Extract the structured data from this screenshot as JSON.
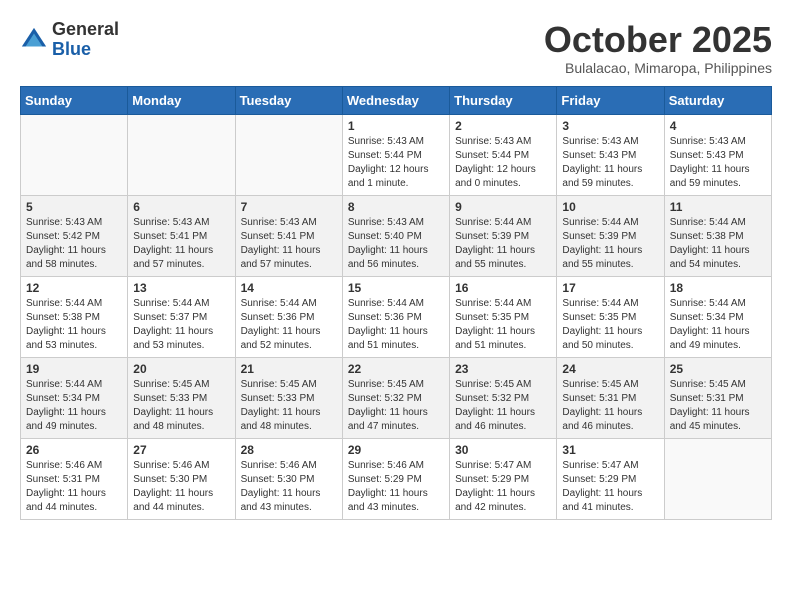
{
  "header": {
    "logo_general": "General",
    "logo_blue": "Blue",
    "month": "October 2025",
    "location": "Bulalacao, Mimaropa, Philippines"
  },
  "calendar": {
    "days_of_week": [
      "Sunday",
      "Monday",
      "Tuesday",
      "Wednesday",
      "Thursday",
      "Friday",
      "Saturday"
    ],
    "weeks": [
      [
        {
          "day": "",
          "info": ""
        },
        {
          "day": "",
          "info": ""
        },
        {
          "day": "",
          "info": ""
        },
        {
          "day": "1",
          "info": "Sunrise: 5:43 AM\nSunset: 5:44 PM\nDaylight: 12 hours\nand 1 minute."
        },
        {
          "day": "2",
          "info": "Sunrise: 5:43 AM\nSunset: 5:44 PM\nDaylight: 12 hours\nand 0 minutes."
        },
        {
          "day": "3",
          "info": "Sunrise: 5:43 AM\nSunset: 5:43 PM\nDaylight: 11 hours\nand 59 minutes."
        },
        {
          "day": "4",
          "info": "Sunrise: 5:43 AM\nSunset: 5:43 PM\nDaylight: 11 hours\nand 59 minutes."
        }
      ],
      [
        {
          "day": "5",
          "info": "Sunrise: 5:43 AM\nSunset: 5:42 PM\nDaylight: 11 hours\nand 58 minutes."
        },
        {
          "day": "6",
          "info": "Sunrise: 5:43 AM\nSunset: 5:41 PM\nDaylight: 11 hours\nand 57 minutes."
        },
        {
          "day": "7",
          "info": "Sunrise: 5:43 AM\nSunset: 5:41 PM\nDaylight: 11 hours\nand 57 minutes."
        },
        {
          "day": "8",
          "info": "Sunrise: 5:43 AM\nSunset: 5:40 PM\nDaylight: 11 hours\nand 56 minutes."
        },
        {
          "day": "9",
          "info": "Sunrise: 5:44 AM\nSunset: 5:39 PM\nDaylight: 11 hours\nand 55 minutes."
        },
        {
          "day": "10",
          "info": "Sunrise: 5:44 AM\nSunset: 5:39 PM\nDaylight: 11 hours\nand 55 minutes."
        },
        {
          "day": "11",
          "info": "Sunrise: 5:44 AM\nSunset: 5:38 PM\nDaylight: 11 hours\nand 54 minutes."
        }
      ],
      [
        {
          "day": "12",
          "info": "Sunrise: 5:44 AM\nSunset: 5:38 PM\nDaylight: 11 hours\nand 53 minutes."
        },
        {
          "day": "13",
          "info": "Sunrise: 5:44 AM\nSunset: 5:37 PM\nDaylight: 11 hours\nand 53 minutes."
        },
        {
          "day": "14",
          "info": "Sunrise: 5:44 AM\nSunset: 5:36 PM\nDaylight: 11 hours\nand 52 minutes."
        },
        {
          "day": "15",
          "info": "Sunrise: 5:44 AM\nSunset: 5:36 PM\nDaylight: 11 hours\nand 51 minutes."
        },
        {
          "day": "16",
          "info": "Sunrise: 5:44 AM\nSunset: 5:35 PM\nDaylight: 11 hours\nand 51 minutes."
        },
        {
          "day": "17",
          "info": "Sunrise: 5:44 AM\nSunset: 5:35 PM\nDaylight: 11 hours\nand 50 minutes."
        },
        {
          "day": "18",
          "info": "Sunrise: 5:44 AM\nSunset: 5:34 PM\nDaylight: 11 hours\nand 49 minutes."
        }
      ],
      [
        {
          "day": "19",
          "info": "Sunrise: 5:44 AM\nSunset: 5:34 PM\nDaylight: 11 hours\nand 49 minutes."
        },
        {
          "day": "20",
          "info": "Sunrise: 5:45 AM\nSunset: 5:33 PM\nDaylight: 11 hours\nand 48 minutes."
        },
        {
          "day": "21",
          "info": "Sunrise: 5:45 AM\nSunset: 5:33 PM\nDaylight: 11 hours\nand 48 minutes."
        },
        {
          "day": "22",
          "info": "Sunrise: 5:45 AM\nSunset: 5:32 PM\nDaylight: 11 hours\nand 47 minutes."
        },
        {
          "day": "23",
          "info": "Sunrise: 5:45 AM\nSunset: 5:32 PM\nDaylight: 11 hours\nand 46 minutes."
        },
        {
          "day": "24",
          "info": "Sunrise: 5:45 AM\nSunset: 5:31 PM\nDaylight: 11 hours\nand 46 minutes."
        },
        {
          "day": "25",
          "info": "Sunrise: 5:45 AM\nSunset: 5:31 PM\nDaylight: 11 hours\nand 45 minutes."
        }
      ],
      [
        {
          "day": "26",
          "info": "Sunrise: 5:46 AM\nSunset: 5:31 PM\nDaylight: 11 hours\nand 44 minutes."
        },
        {
          "day": "27",
          "info": "Sunrise: 5:46 AM\nSunset: 5:30 PM\nDaylight: 11 hours\nand 44 minutes."
        },
        {
          "day": "28",
          "info": "Sunrise: 5:46 AM\nSunset: 5:30 PM\nDaylight: 11 hours\nand 43 minutes."
        },
        {
          "day": "29",
          "info": "Sunrise: 5:46 AM\nSunset: 5:29 PM\nDaylight: 11 hours\nand 43 minutes."
        },
        {
          "day": "30",
          "info": "Sunrise: 5:47 AM\nSunset: 5:29 PM\nDaylight: 11 hours\nand 42 minutes."
        },
        {
          "day": "31",
          "info": "Sunrise: 5:47 AM\nSunset: 5:29 PM\nDaylight: 11 hours\nand 41 minutes."
        },
        {
          "day": "",
          "info": ""
        }
      ]
    ]
  }
}
